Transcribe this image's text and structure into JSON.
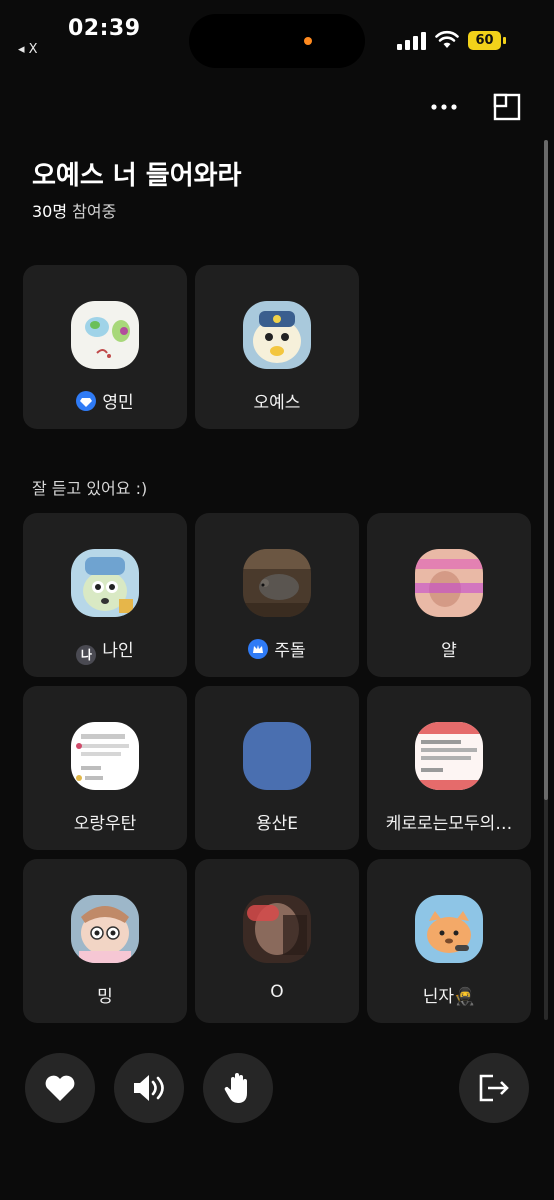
{
  "status_bar": {
    "back_label": "◂ X",
    "time": "02:39",
    "battery": "60"
  },
  "room": {
    "title": "오예스 너 들어와라",
    "participants": "30명",
    "participants_suffix": " 참여중"
  },
  "speakers": [
    {
      "name": "영민",
      "badge": "diamond-badge"
    },
    {
      "name": "오예스",
      "badge": ""
    }
  ],
  "listeners_label": "잘 듣고 있어요 :)",
  "listeners": [
    {
      "name": "나인",
      "badge": "나"
    },
    {
      "name": "주돌",
      "badge": "crown-badge"
    },
    {
      "name": "얄"
    },
    {
      "name": "오랑우탄"
    },
    {
      "name": "용산E"
    },
    {
      "name": "케로로는모두의…"
    },
    {
      "name": "밍"
    },
    {
      "name": "O"
    },
    {
      "name": "닌자🥷"
    }
  ],
  "controls": {
    "like": "heart-icon",
    "speaker": "speaker-icon",
    "raise_hand": "hand-icon",
    "leave": "exit-icon"
  },
  "colors": {
    "background": "#0b0b0b",
    "card": "#1f1f1f",
    "accent_blue": "#2f7bf6",
    "battery": "#f2d21a"
  }
}
